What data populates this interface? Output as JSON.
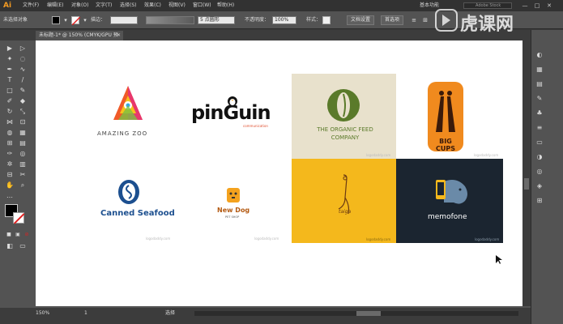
{
  "menubar": {
    "logo": "Ai",
    "items": [
      "文件(F)",
      "编辑(E)",
      "对象(O)",
      "文字(T)",
      "选择(S)",
      "效果(C)",
      "视图(V)",
      "窗口(W)",
      "帮助(H)"
    ],
    "workspace": "基本功能",
    "search_placeholder": "Adobe Stock",
    "win_min": "—",
    "win_max": "□",
    "win_close": "✕"
  },
  "controlbar": {
    "selection_status": "未选择对象",
    "stroke_label": "描边：",
    "brush_value": "5 点圆形",
    "opacity_label": "不透明度：",
    "opacity_value": "100%",
    "style_label": "样式：",
    "doc_setup": "文档设置",
    "preferences": "首选项"
  },
  "tab": {
    "title": "未标题-1* @ 150% (CMYK/GPU 预览)",
    "close": "✕"
  },
  "status": {
    "zoom": "150%",
    "page": "1",
    "mode": "选择"
  },
  "logos": {
    "amazing_zoo": "AMAZING ZOO",
    "pinguin": "pinGuin",
    "pinguin_sub": "communication",
    "organic_1": "THE ORGANIC FEED",
    "organic_2": "COMPANY",
    "organic_caption": "logodaddy.com",
    "big_cups": "BIG CUPS",
    "big_cups_caption": "logodaddy.com",
    "canned": "Canned Seafood",
    "canned_caption": "logodaddy.com",
    "new_dog": "New Dog",
    "new_dog_sub": "PET SHOP",
    "new_dog_caption": "logodaddy.com",
    "taiga": "taiga",
    "taiga_caption": "logodaddy.com",
    "memofone": "memofone",
    "memofone_caption": "logodaddy.com"
  },
  "watermark": {
    "text": "虎课网"
  },
  "colors": {
    "organic_bg": "#e8e1cc",
    "organic_green": "#5a7a2a",
    "big_cups_orange": "#f08a1e",
    "taiga_yellow": "#f4b81c",
    "memofone_bg": "#1b2530",
    "canned_blue": "#1c4f8f",
    "new_dog_orange": "#f4a21e"
  }
}
